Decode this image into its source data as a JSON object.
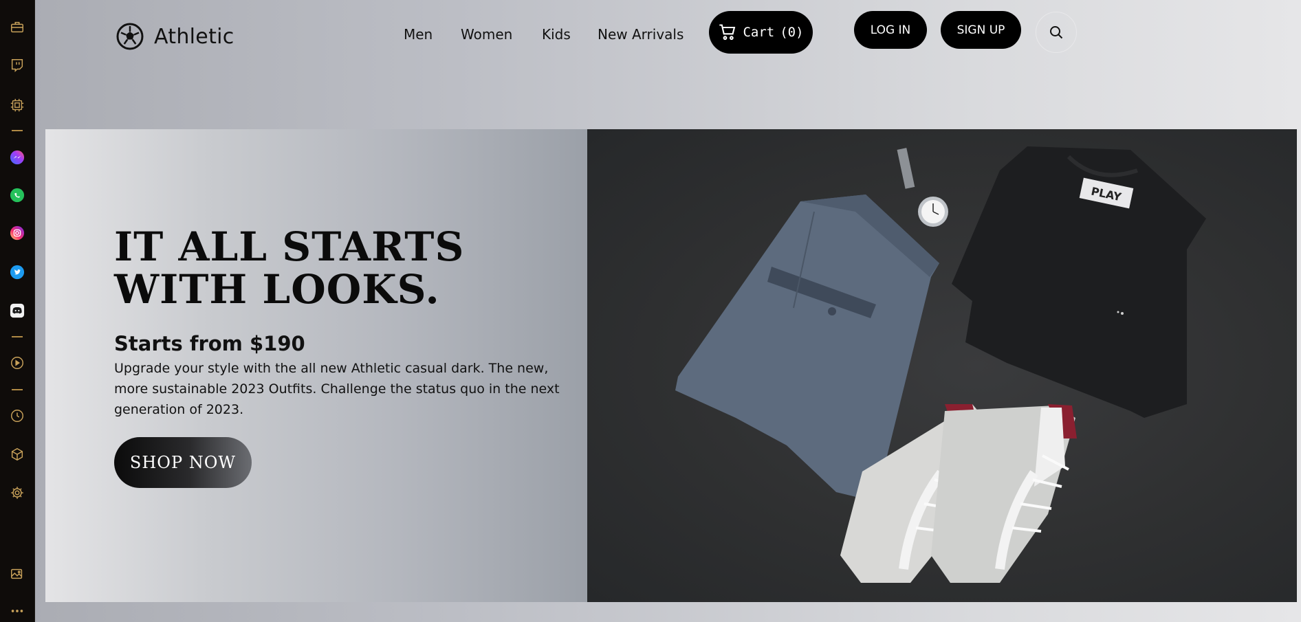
{
  "sidebar": {
    "items": [
      {
        "icon": "briefcase-icon"
      },
      {
        "icon": "twitch-icon"
      },
      {
        "icon": "chip-icon"
      },
      {
        "icon": "messenger-icon"
      },
      {
        "icon": "whatsapp-icon"
      },
      {
        "icon": "instagram-icon"
      },
      {
        "icon": "twitter-icon"
      },
      {
        "icon": "discord-icon"
      },
      {
        "icon": "play-icon"
      },
      {
        "icon": "clock-icon"
      },
      {
        "icon": "cube-icon"
      },
      {
        "icon": "gear-icon"
      },
      {
        "icon": "gallery-icon"
      },
      {
        "icon": "more-icon"
      }
    ],
    "accent": "#c9a25a"
  },
  "header": {
    "logo_text": "Athletic",
    "nav": [
      "Men",
      "Women",
      "Kids",
      "New Arrivals"
    ],
    "cart_label": "Cart",
    "cart_count": "(0)",
    "login_label": "LOG IN",
    "signup_label": "SIGN UP",
    "search_icon": "search-icon"
  },
  "hero": {
    "headline": "IT ALL STARTS WITH LOOKS.",
    "price_line": "Starts from $190",
    "description": "Upgrade your style with the all new Athletic casual dark. The new, more sustainable 2023 Outfits. Challenge the status quo in the next generation of 2023.",
    "cta_label": "SHOP NOW",
    "tshirt_label": "PLAY"
  }
}
